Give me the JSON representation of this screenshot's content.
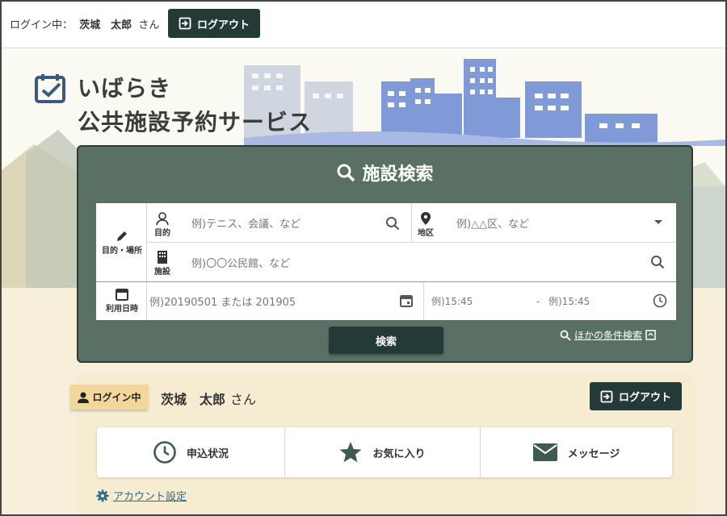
{
  "topbar": {
    "status_prefix": "ログイン中：",
    "user_name": "茨城　太郎",
    "honorific": "さん",
    "logout_label": "ログアウト"
  },
  "brand": {
    "line1": "いばらき",
    "line2": "公共施設予約サービス"
  },
  "search": {
    "title": "施設検索",
    "purpose_place_label": "目的・場所",
    "purpose_caption": "目的",
    "purpose_placeholder": "例)テニス、会議、など",
    "area_caption": "地区",
    "area_placeholder": "例)△△区、など",
    "facility_caption": "施設",
    "facility_placeholder": "例)〇〇公民館、など",
    "datetime_label": "利用日時",
    "date_placeholder": "例)20190501 または 201905",
    "time_from_placeholder": "例)15:45",
    "time_separator": "-",
    "time_to_placeholder": "例)15:45",
    "search_button": "検索",
    "other_conditions": "ほかの条件検索"
  },
  "login": {
    "badge": "ログイン中",
    "user_name": "茨城　太郎",
    "honorific": "さん",
    "logout_label": "ログアウト"
  },
  "menu": {
    "items": [
      {
        "label": "申込状況",
        "icon": "clock-icon"
      },
      {
        "label": "お気に入り",
        "icon": "star-icon"
      },
      {
        "label": "メッセージ",
        "icon": "mail-icon"
      }
    ],
    "account_settings": "アカウント設定"
  },
  "colors": {
    "panel": "#5a7065",
    "dark_button": "#243a36",
    "badge": "#f3d79a",
    "cream": "#f7efd9"
  }
}
